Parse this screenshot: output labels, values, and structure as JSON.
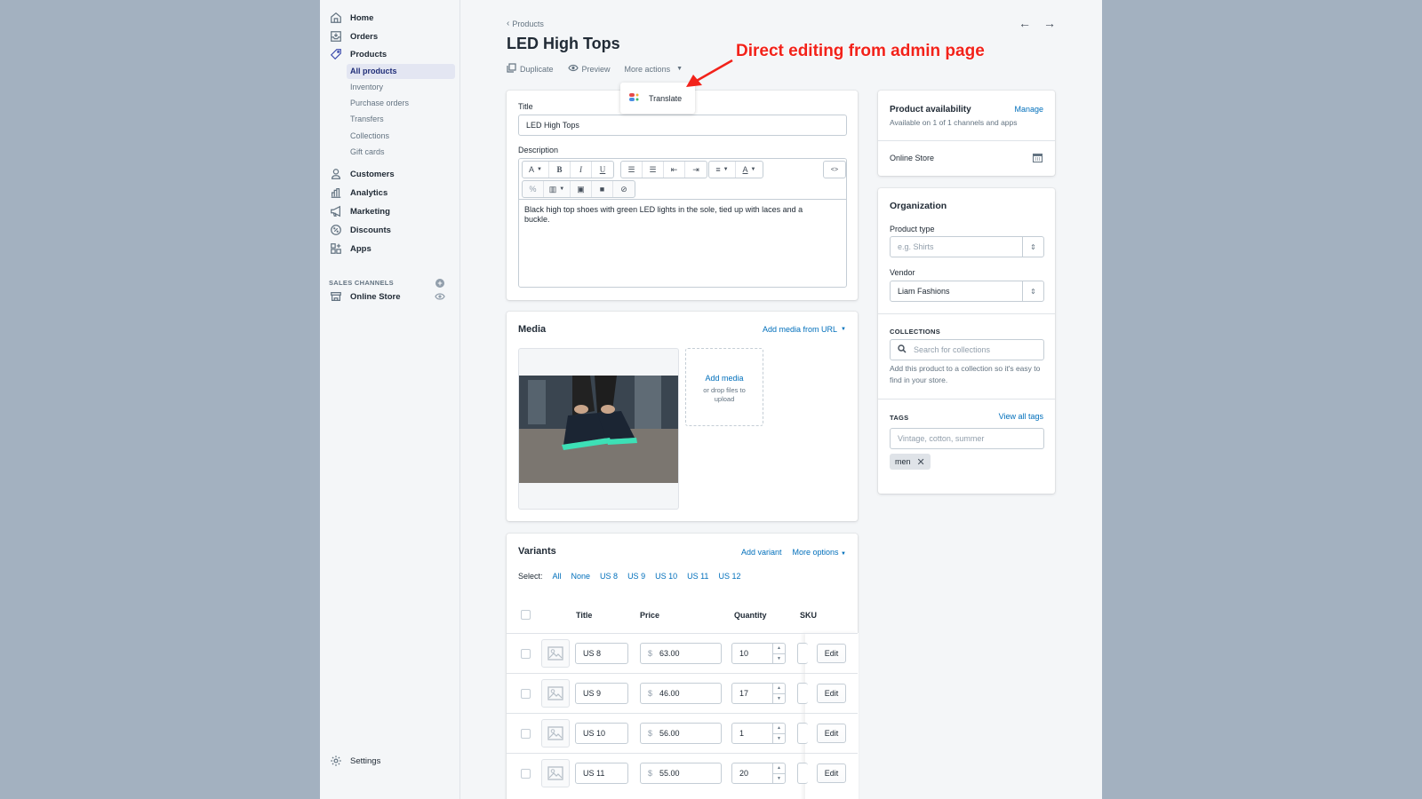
{
  "sidebar": {
    "nav": [
      {
        "label": "Home",
        "icon": "home-icon"
      },
      {
        "label": "Orders",
        "icon": "inbox-icon"
      },
      {
        "label": "Products",
        "icon": "tag-icon"
      },
      {
        "label": "Customers",
        "icon": "person-icon"
      },
      {
        "label": "Analytics",
        "icon": "bar-chart-icon"
      },
      {
        "label": "Marketing",
        "icon": "megaphone-icon"
      },
      {
        "label": "Discounts",
        "icon": "discount-icon"
      },
      {
        "label": "Apps",
        "icon": "apps-icon"
      }
    ],
    "product_subnav": [
      "All products",
      "Inventory",
      "Purchase orders",
      "Transfers",
      "Collections",
      "Gift cards"
    ],
    "active_sub": "All products",
    "sales_channels_header": "SALES CHANNELS",
    "online_store": "Online Store",
    "settings": "Settings"
  },
  "header": {
    "breadcrumb": "Products",
    "title": "LED High Tops",
    "actions": {
      "duplicate": "Duplicate",
      "preview": "Preview",
      "more": "More actions"
    },
    "dropdown_item": "Translate"
  },
  "annotation": {
    "text": "Direct editing from admin page",
    "color": "#f2221a"
  },
  "product": {
    "title_label": "Title",
    "title_value": "LED High Tops",
    "description_label": "Description",
    "description": "Black high top shoes with green LED lights in the sole, tied up with laces and a buckle.",
    "toolbar": {
      "font": "A",
      "bold": "B",
      "italic": "I",
      "underline": "U",
      "html": "<>"
    }
  },
  "media": {
    "title": "Media",
    "add_from_url": "Add media from URL",
    "add_media": "Add media",
    "drop_hint": "or drop files to upload"
  },
  "variants": {
    "title": "Variants",
    "add_variant": "Add variant",
    "more_options": "More options",
    "select_label": "Select:",
    "select_options": [
      "All",
      "None",
      "US 8",
      "US 9",
      "US 10",
      "US 11",
      "US 12"
    ],
    "columns": {
      "title": "Title",
      "price": "Price",
      "quantity": "Quantity",
      "sku": "SKU"
    },
    "currency": "$",
    "edit_label": "Edit",
    "rows": [
      {
        "title": "US 8",
        "price": "63.00",
        "quantity": "10"
      },
      {
        "title": "US 9",
        "price": "46.00",
        "quantity": "17"
      },
      {
        "title": "US 10",
        "price": "56.00",
        "quantity": "1"
      },
      {
        "title": "US 11",
        "price": "55.00",
        "quantity": "20"
      }
    ]
  },
  "availability": {
    "title": "Product availability",
    "manage": "Manage",
    "subtitle": "Available on 1 of 1 channels and apps",
    "channel": "Online Store"
  },
  "organization": {
    "title": "Organization",
    "product_type_label": "Product type",
    "product_type_placeholder": "e.g. Shirts",
    "vendor_label": "Vendor",
    "vendor_value": "Liam Fashions",
    "collections_header": "COLLECTIONS",
    "collections_placeholder": "Search for collections",
    "collections_help": "Add this product to a collection so it's easy to find in your store.",
    "tags_header": "TAGS",
    "view_all_tags": "View all tags",
    "tags_placeholder": "Vintage, cotton, summer",
    "tags": [
      "men"
    ]
  }
}
